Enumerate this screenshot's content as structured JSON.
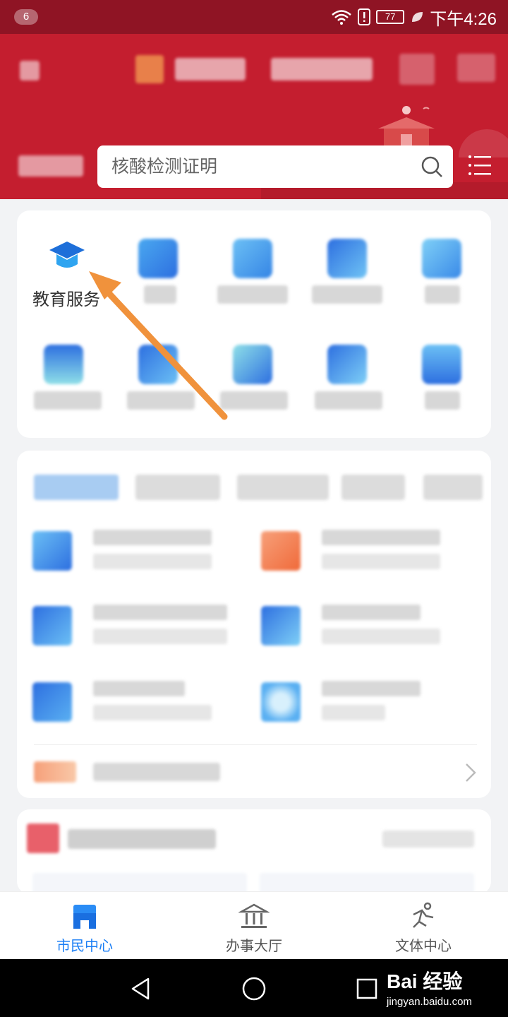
{
  "status_bar": {
    "notification_count": "6",
    "battery_level": "77",
    "time": "下午4:26",
    "icons": [
      "wifi-icon",
      "alert-icon",
      "battery-icon",
      "leaf-icon"
    ]
  },
  "header": {
    "search_placeholder": "核酸检测证明",
    "icons": [
      "back-icon",
      "search-icon",
      "menu-icon"
    ]
  },
  "services_grid": {
    "items": [
      {
        "label": "教育服务",
        "icon": "graduation-cap-icon"
      }
    ]
  },
  "bottom_nav": {
    "items": [
      {
        "label": "市民中心",
        "icon": "citizen-center-icon",
        "active": true
      },
      {
        "label": "办事大厅",
        "icon": "service-hall-icon",
        "active": false
      },
      {
        "label": "文体中心",
        "icon": "culture-sports-icon",
        "active": false
      }
    ]
  },
  "system_nav": {
    "watermark_main": "Bai 经验",
    "watermark_sub": "jingyan.baidu.com"
  },
  "colors": {
    "header_red": "#c41e2f",
    "status_bar": "#8f1424",
    "active_blue": "#1a7ef5",
    "arrow_orange": "#f0923c"
  }
}
